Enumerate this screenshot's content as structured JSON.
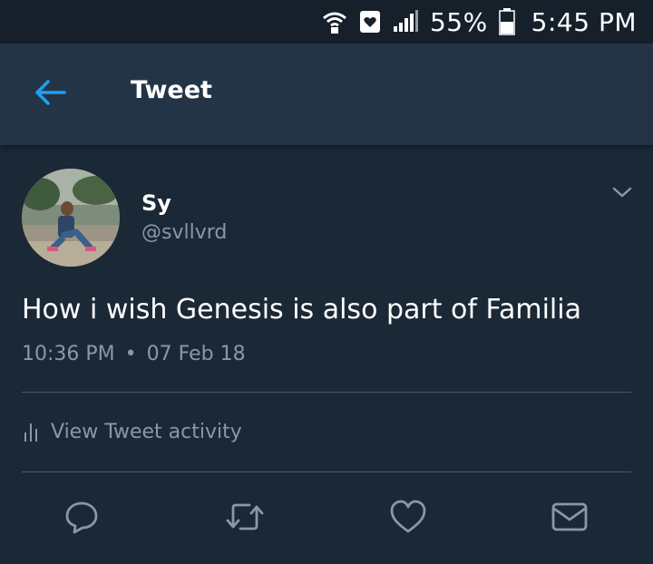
{
  "status_bar": {
    "battery": "55%",
    "time": "5:45 PM",
    "icons": [
      "wifi-icon",
      "notification-icon",
      "signal-icon",
      "battery-icon"
    ]
  },
  "app_bar": {
    "title": "Tweet",
    "back_icon": "back-arrow-icon"
  },
  "tweet": {
    "author_name": "Sy",
    "author_handle": "@svllvrd",
    "text": "How i wish Genesis is also part of Familia",
    "time": "10:36 PM",
    "separator": "•",
    "date": "07 Feb 18",
    "activity_label": "View Tweet activity",
    "actions": [
      "reply-icon",
      "retweet-icon",
      "like-icon",
      "direct-message-icon"
    ]
  },
  "colors": {
    "background": "#1b2836",
    "app_bar": "#243447",
    "status_bar": "#16202b",
    "accent": "#1da1f2",
    "secondary_text": "#8899a6"
  }
}
